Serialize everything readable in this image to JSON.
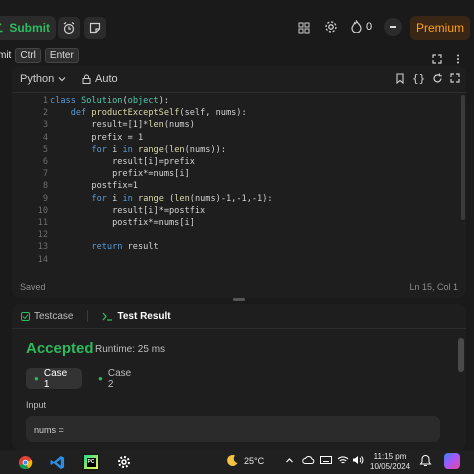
{
  "toolbar": {
    "submit_label": "Submit",
    "notification_count": "0",
    "premium_label": "Premium"
  },
  "shortcut": {
    "prefix": "mit",
    "key1": "Ctrl",
    "key2": "Enter"
  },
  "editor": {
    "language": "Python",
    "mode": "Auto",
    "lines": [
      {
        "n": "1",
        "text": "class Solution(object):"
      },
      {
        "n": "2",
        "text": "    def productExceptSelf(self, nums):"
      },
      {
        "n": "3",
        "text": "        result=[1]*len(nums)"
      },
      {
        "n": "4",
        "text": "        prefix = 1"
      },
      {
        "n": "5",
        "text": "        for i in range(len(nums)):"
      },
      {
        "n": "6",
        "text": "            result[i]=prefix"
      },
      {
        "n": "7",
        "text": "            prefix*=nums[i]"
      },
      {
        "n": "8",
        "text": "        postfix=1"
      },
      {
        "n": "9",
        "text": "        for i in range (len(nums)-1,-1,-1):"
      },
      {
        "n": "10",
        "text": "            result[i]*=postfix"
      },
      {
        "n": "11",
        "text": "            postfix*=nums[i]"
      },
      {
        "n": "12",
        "text": ""
      },
      {
        "n": "13",
        "text": "        return result"
      },
      {
        "n": "14",
        "text": ""
      }
    ],
    "status_left": "Saved",
    "status_right": "Ln 15, Col 1"
  },
  "results": {
    "tab_testcase": "Testcase",
    "tab_result": "Test Result",
    "verdict": "Accepted",
    "runtime": "Runtime: 25 ms",
    "case1": "Case 1",
    "case2": "Case 2",
    "input_label": "Input",
    "input_value": "nums ="
  },
  "taskbar": {
    "temperature": "25°C",
    "time": "11:15 pm",
    "date": "10/05/2024"
  },
  "colors": {
    "accent_green": "#2cbb5d",
    "premium_orange": "#ffa116"
  }
}
